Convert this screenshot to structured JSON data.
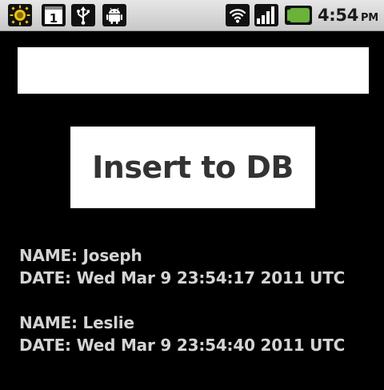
{
  "status_bar": {
    "time": "4:54",
    "ampm": "PM",
    "calendar_day": "1",
    "icons": [
      "sun-notification-icon",
      "calendar-icon",
      "usb-icon",
      "android-debug-icon",
      "wifi-icon",
      "signal-icon",
      "battery-icon"
    ]
  },
  "form": {
    "input_value": "",
    "insert_button_label": "Insert to DB"
  },
  "records": [
    {
      "name_line": "NAME: Joseph",
      "date_line": "DATE: Wed Mar 9 23:54:17 2011 UTC"
    },
    {
      "name_line": "NAME: Leslie",
      "date_line": "DATE: Wed Mar 9 23:54:40 2011 UTC"
    }
  ],
  "colors": {
    "background": "#000000",
    "status_bar": "#d6d6d6",
    "text": "#d4d4d4",
    "battery": "#6ab23a",
    "button_text": "#333333"
  }
}
